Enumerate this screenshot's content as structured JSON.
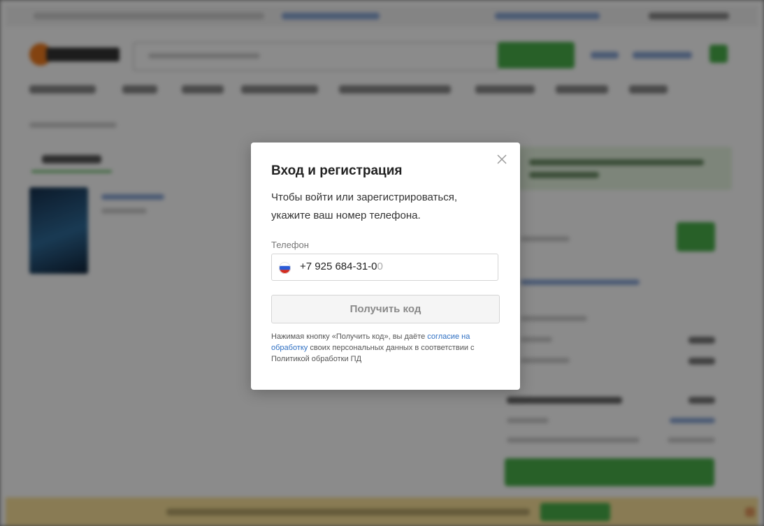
{
  "modal": {
    "title": "Вход и регистрация",
    "description": "Чтобы войти или зарегистрироваться, укажите ваш номер телефона.",
    "phone_label": "Телефон",
    "phone_value": "+7 925 684-31-0",
    "phone_value_trailing": "0",
    "phone_country_flag": "russia-flag-icon",
    "submit_label": "Получить код",
    "consent_prefix": "Нажимая кнопку «Получить код», вы даёте ",
    "consent_link": "согласие на обработку",
    "consent_suffix": " своих персональных данных в соответствии с Политикой обработки ПД",
    "close_icon": "close-icon"
  },
  "colors": {
    "link": "#2e6fc2",
    "overlay": "rgba(0,0,0,0.45)",
    "button_text": "#8a8a8a",
    "brand_green": "#49b04a",
    "brand_orange": "#f07b1d"
  }
}
